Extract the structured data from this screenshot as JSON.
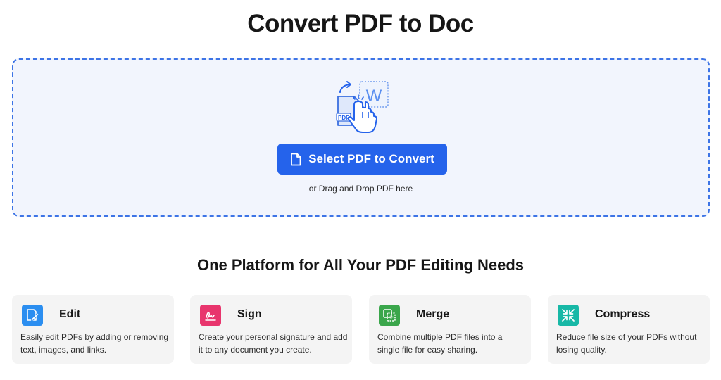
{
  "page": {
    "title": "Convert PDF to Doc"
  },
  "dropzone": {
    "button_label": "Select PDF to Convert",
    "hint": "or Drag and Drop PDF here",
    "illustration_badge_pdf": "PDF",
    "illustration_badge_word": "W"
  },
  "features": {
    "heading": "One Platform for All Your PDF Editing Needs",
    "items": [
      {
        "title": "Edit",
        "description": "Easily edit PDFs by adding or removing text, images, and links.",
        "icon": "edit-icon",
        "color": "#2b8ef0"
      },
      {
        "title": "Sign",
        "description": "Create your personal signature and add it to any document you create.",
        "icon": "signature-icon",
        "color": "#e8356d"
      },
      {
        "title": "Merge",
        "description": "Combine multiple PDF files into a single file for easy sharing.",
        "icon": "merge-icon",
        "color": "#3aa64b"
      },
      {
        "title": "Compress",
        "description": "Reduce file size of your PDFs without losing quality.",
        "icon": "compress-icon",
        "color": "#17b8a6"
      }
    ]
  },
  "colors": {
    "accent": "#2563eb",
    "dropzone_border": "#3d74e6",
    "dropzone_bg": "#f2f5fd",
    "card_bg": "#f4f4f4"
  }
}
